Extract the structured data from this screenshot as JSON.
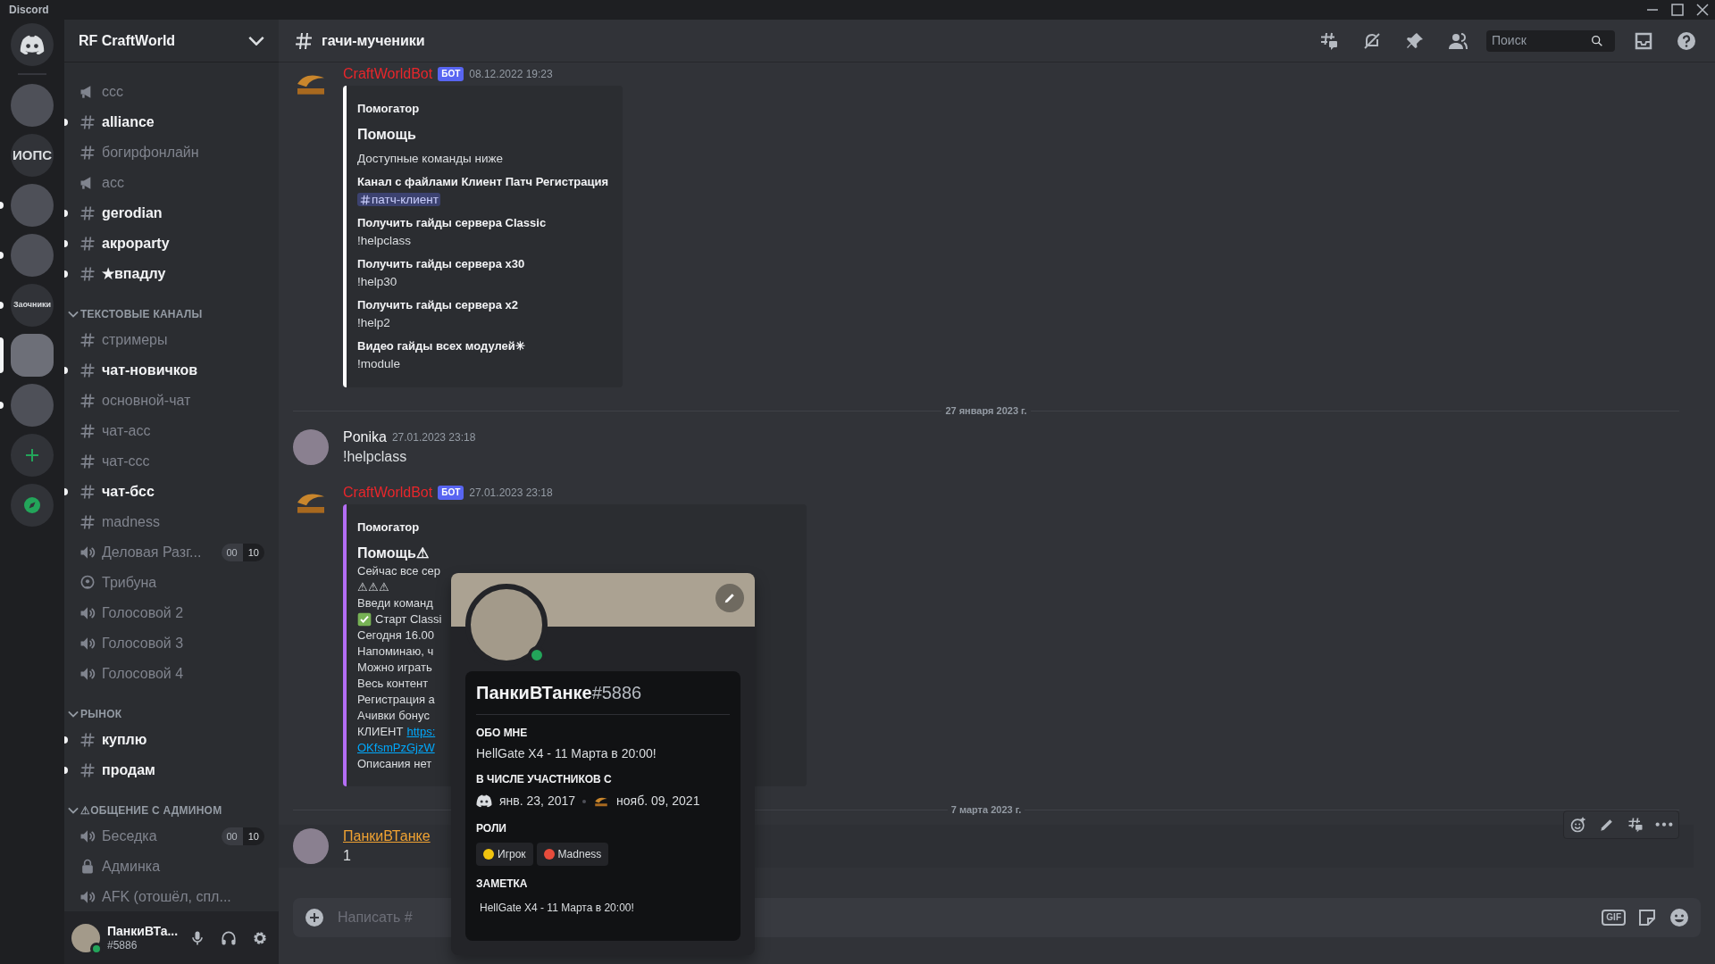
{
  "window": {
    "title": "Discord"
  },
  "servers": [
    {
      "kind": "home",
      "selected": false,
      "unread": false
    },
    {
      "kind": "image",
      "selected": false,
      "unread": false
    },
    {
      "kind": "text",
      "label": "ИОПС",
      "selected": false,
      "unread": false
    },
    {
      "kind": "image",
      "selected": false,
      "unread": true
    },
    {
      "kind": "image",
      "selected": false,
      "unread": true
    },
    {
      "kind": "text",
      "label": "Заочники",
      "selected": false,
      "unread": true
    },
    {
      "kind": "image",
      "selected": true,
      "unread": false
    },
    {
      "kind": "image",
      "selected": false,
      "unread": true
    },
    {
      "kind": "add"
    },
    {
      "kind": "explore"
    }
  ],
  "sidebar": {
    "server_name": "RF CraftWorld",
    "items": [
      {
        "kind": "announcement",
        "name": "ccc",
        "unread": false
      },
      {
        "kind": "text",
        "name": "alliance",
        "unread": true
      },
      {
        "kind": "text",
        "name": "богирфонлайн",
        "unread": false
      },
      {
        "kind": "announcement",
        "name": "acc",
        "unread": false
      },
      {
        "kind": "text",
        "name": "gerodian",
        "unread": true
      },
      {
        "kind": "text",
        "name": "акроparty",
        "unread": true
      },
      {
        "kind": "text",
        "name": "★впадлу",
        "unread": true
      },
      {
        "kind": "category",
        "name": "ТЕКСТОВЫЕ КАНАЛЫ",
        "expanded": true
      },
      {
        "kind": "text",
        "name": "стримеры",
        "unread": false
      },
      {
        "kind": "text",
        "name": "чат-новичков",
        "unread": true
      },
      {
        "kind": "text",
        "name": "основной-чат",
        "unread": false
      },
      {
        "kind": "text",
        "name": "чат-асс",
        "unread": false
      },
      {
        "kind": "text",
        "name": "чат-ссс",
        "unread": false
      },
      {
        "kind": "text",
        "name": "чат-бсс",
        "unread": true
      },
      {
        "kind": "text",
        "name": "madness",
        "unread": false
      },
      {
        "kind": "voice",
        "name": "Деловая Разг...",
        "unread": false,
        "users": "00",
        "limit": "10"
      },
      {
        "kind": "stage",
        "name": "Трибуна",
        "unread": false
      },
      {
        "kind": "voice",
        "name": "Голосовой 2",
        "unread": false
      },
      {
        "kind": "voice",
        "name": "Голосовой 3",
        "unread": false
      },
      {
        "kind": "voice",
        "name": "Голосовой 4",
        "unread": false
      },
      {
        "kind": "category",
        "name": "РЫНОК",
        "expanded": true
      },
      {
        "kind": "text",
        "name": "куплю",
        "unread": true
      },
      {
        "kind": "text",
        "name": "продам",
        "unread": true
      },
      {
        "kind": "category",
        "name": "⚠ОБЩЕНИЕ С АДМИНОМ",
        "expanded": true
      },
      {
        "kind": "voice",
        "name": "Беседка",
        "unread": false,
        "users": "00",
        "limit": "10"
      },
      {
        "kind": "locked",
        "name": "Админка",
        "unread": false
      },
      {
        "kind": "voice",
        "name": "AFK (отошёл, спл...",
        "unread": false
      }
    ]
  },
  "user_panel": {
    "name": "ПанкиВТа...",
    "tag": "#5886",
    "online": true
  },
  "header": {
    "channel": "гачи-мученики",
    "search_placeholder": "Поиск"
  },
  "messages": [
    {
      "kind": "message",
      "author": "CraftWorldBot",
      "color": "#e8262b",
      "bot_tag": "БОТ",
      "timestamp": "08.12.2022 19:23",
      "avatar": {
        "kind": "logo"
      },
      "hovered": false,
      "embed": {
        "color": "#ffffff",
        "author": "Помогатор",
        "title": "Помощь",
        "description": "Доступные команды ниже",
        "fields": [
          {
            "kind": "mention",
            "name": "Канал с файлами Клиент Патч Регистрация",
            "value": "патч-клиент"
          },
          {
            "kind": "plain",
            "name": "Получить гайды сервера Classic",
            "value": "!helpclass"
          },
          {
            "kind": "plain",
            "name": "Получить гайды сервера x30",
            "value": "!help30"
          },
          {
            "kind": "plain",
            "name": "Получить гайды сервера x2",
            "value": "!help2"
          },
          {
            "kind": "plain",
            "name": "Видео гайды всех модулей✳",
            "value": "!module"
          }
        ]
      }
    },
    {
      "kind": "divider",
      "label": "27 января 2023 г."
    },
    {
      "kind": "message",
      "author": "Ponika",
      "color": "#f2f3f5",
      "timestamp": "27.01.2023 23:18",
      "avatar": {
        "kind": "photo"
      },
      "hovered": false,
      "text": "!helpclass"
    },
    {
      "kind": "message",
      "author": "CraftWorldBot",
      "color": "#e8262b",
      "bot_tag": "БОТ",
      "timestamp": "27.01.2023 23:18",
      "avatar": {
        "kind": "logo"
      },
      "hovered": false,
      "embed": {
        "color": "#b46ef5",
        "author": "Помогатор",
        "title": "Помощь⚠",
        "lines": [
          {
            "kind": "plain",
            "text": "Сейчас все сер"
          },
          {
            "kind": "plain",
            "text": "⚠⚠⚠"
          },
          {
            "kind": "plain",
            "text": "Введи команд"
          },
          {
            "kind": "check",
            "text": "Старт Classi"
          },
          {
            "kind": "plain",
            "text": "Сегодня 16.00"
          },
          {
            "kind": "plain",
            "text": "Напоминаю, ч"
          },
          {
            "kind": "plain",
            "text": "Можно играть"
          },
          {
            "kind": "plain",
            "text": "Весь контент"
          },
          {
            "kind": "plain",
            "text": "Регистрация а"
          },
          {
            "kind": "plain",
            "text": "Ачивки бонус"
          },
          {
            "kind": "link",
            "text": "КЛИЕНТ",
            "link": "https:"
          },
          {
            "kind": "link",
            "link": "OKfsmPzGjzW"
          },
          {
            "kind": "plain",
            "text": "Описания нет"
          }
        ]
      }
    },
    {
      "kind": "divider",
      "label": "7 марта 2023 г."
    },
    {
      "kind": "message",
      "author": "ПанкиВТанке",
      "color": "#f0a232",
      "avatar": {
        "kind": "photo"
      },
      "hovered": true,
      "text": "1"
    }
  ],
  "composer": {
    "placeholder": "Написать #",
    "gif_label": "GIF"
  },
  "profile_popup": {
    "name": "ПанкиВТанке",
    "tag": "#5886",
    "online": true,
    "about_title": "ОБО МНЕ",
    "about": "HellGate X4 - 11 Марта в 20:00!",
    "member_title": "В ЧИСЛЕ УЧАСТНИКОВ С",
    "member_since": [
      {
        "kind": "discord",
        "date": "янв. 23, 2017"
      },
      {
        "kind": "server",
        "date": "нояб. 09, 2021"
      }
    ],
    "roles_title": "РОЛИ",
    "roles": [
      {
        "name": "Игрок",
        "color": "#f1c40f"
      },
      {
        "name": "Madness",
        "color": "#e74c3c"
      }
    ],
    "note_title": "ЗАМЕТКА",
    "note": "HellGate X4 - 11 Марта в 20:00!"
  }
}
